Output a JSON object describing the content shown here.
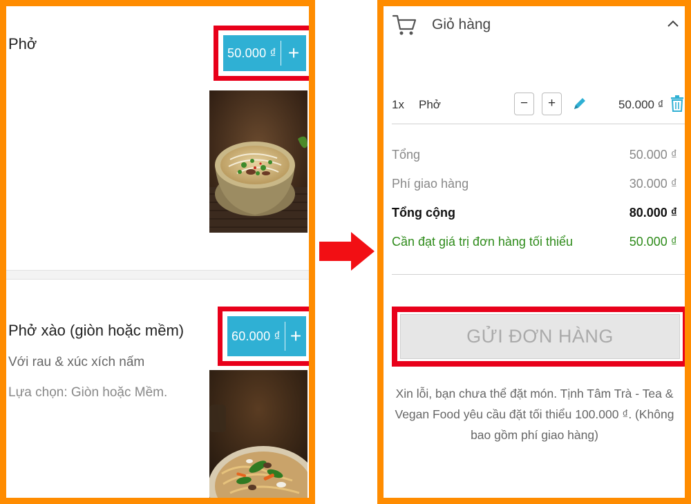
{
  "menu": {
    "items": [
      {
        "name": "Phở",
        "price": "50.000 ₫",
        "add_symbol": "+"
      },
      {
        "name": "Phở xào (giòn hoặc mềm)",
        "description": "Với rau & xúc xích nấm",
        "options": "Lựa chọn: Giòn hoặc Mềm.",
        "price": "60.000 ₫",
        "add_symbol": "+"
      }
    ]
  },
  "cart": {
    "title": "Giỏ hàng",
    "line": {
      "qty": "1x",
      "name": "Phở",
      "minus": "−",
      "plus": "+",
      "price": "50.000 ₫"
    },
    "summary": {
      "subtotal_label": "Tổng",
      "subtotal_value": "50.000 ₫",
      "delivery_label": "Phí giao hàng",
      "delivery_value": "30.000 ₫",
      "total_label": "Tổng cộng",
      "total_value": "80.000 ₫",
      "minimum_label": "Cần đạt giá trị đơn hàng tối thiểu",
      "minimum_value": "50.000 ₫"
    },
    "submit_label": "GỬI ĐƠN HÀNG",
    "notice": "Xin lỗi, bạn chưa thể đặt món. Tịnh Tâm Trà - Tea & Vegan Food yêu cầu đặt tối thiểu 100.000 ₫. (Không bao gồm phí giao hàng)"
  },
  "colors": {
    "frame": "#ff8c00",
    "highlight": "#e8001a",
    "price_button": "#2fb0d4",
    "warning_text": "#2e8b1a",
    "delete_icon": "#2fb0d4"
  }
}
